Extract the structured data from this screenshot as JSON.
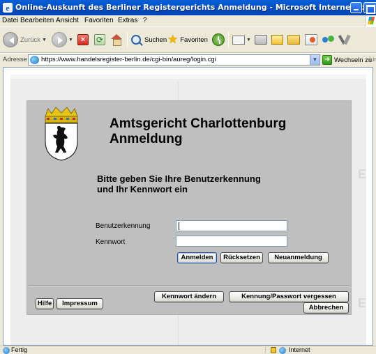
{
  "window": {
    "title": "Online-Auskunft des Berliner Registergerichts Anmeldung - Microsoft Internet Explorer"
  },
  "menu": {
    "items": [
      "Datei",
      "Bearbeiten",
      "Ansicht",
      "Favoriten",
      "Extras",
      "?"
    ]
  },
  "toolbar": {
    "back_label": "Zurück",
    "search_label": "Suchen",
    "favorites_label": "Favoriten",
    "icons": [
      "back-icon",
      "forward-icon",
      "stop-icon",
      "refresh-icon",
      "home-icon",
      "search-icon",
      "favorites-star-icon",
      "history-icon",
      "mail-icon",
      "print-icon",
      "edit-icon",
      "folder-icon",
      "research-icon",
      "messenger-icon",
      "tools-icon"
    ]
  },
  "address": {
    "label": "Adresse",
    "url": "https://www.handelsregister-berlin.de/cgi-bin/aureg/login.cgi",
    "go_label": "Wechseln zu",
    "links_label": "Lir"
  },
  "page": {
    "heading_line1": "Amtsgericht Charlottenburg",
    "heading_line2": "Anmeldung",
    "prompt_line1": "Bitte geben Sie Ihre Benutzerkennung",
    "prompt_line2": "und Ihr Kennwort ein",
    "username_label": "Benutzerkennung",
    "password_label": "Kennwort",
    "username_value": "",
    "password_value": "",
    "login_button": "Anmelden",
    "reset_button": "Rücksetzen",
    "register_button": "Neuanmeldung",
    "help_button": "Hilfe",
    "imprint_button": "Impressum",
    "change_password_button": "Kennwort ändern",
    "forgot_button": "Kennung/Passwort vergessen",
    "cancel_button": "Abbrechen",
    "ghost_letter": "E",
    "coat_of_arms": "berlin-coat-of-arms"
  },
  "status": {
    "text": "Fertig",
    "zone": "Internet",
    "icons": [
      "page-icon",
      "lock-icon",
      "internet-zone-icon"
    ]
  },
  "colors": {
    "titlebar": "#0453C9",
    "form_panel": "#BFBFBF",
    "page_background": "#EDEDED"
  }
}
